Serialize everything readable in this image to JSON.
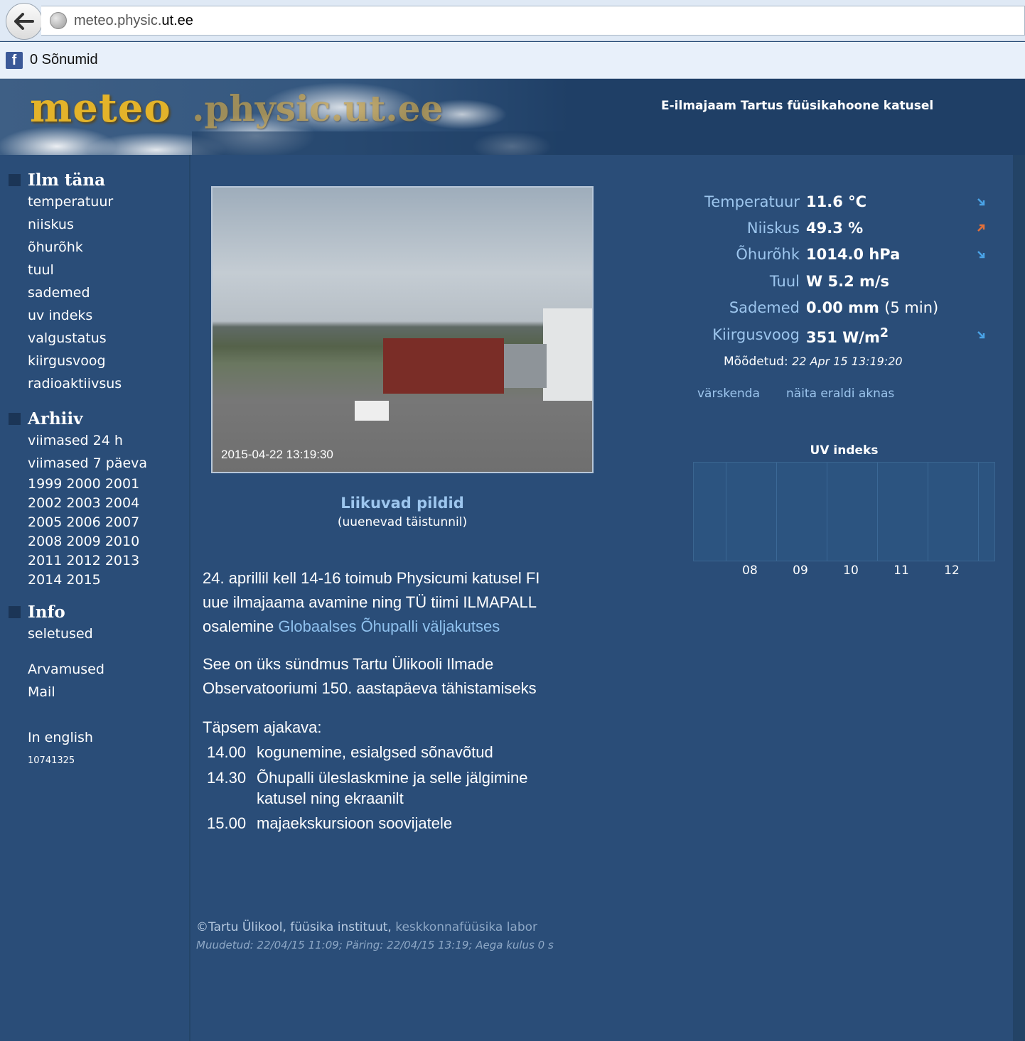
{
  "browser": {
    "url_prefix": "meteo.physic.",
    "url_domain": "ut.ee",
    "bookmark_label": "0 Sõnumid"
  },
  "header": {
    "logo_main": "meteo",
    "logo_domain": ".physic.ut.ee",
    "tagline": "E-ilmajaam Tartus füüsikahoone katusel"
  },
  "sidebar": {
    "today_title": "Ilm täna",
    "today_items": [
      "temperatuur",
      "niiskus",
      "õhurõhk",
      "tuul",
      "sademed",
      "uv indeks",
      "valgustatus",
      "kiirgusvoog",
      "radioaktiivsus"
    ],
    "archive_title": "Arhiiv",
    "archive_items": [
      "viimased 24 h",
      "viimased 7 päeva"
    ],
    "years": [
      [
        "1999",
        "2000",
        "2001"
      ],
      [
        "2002",
        "2003",
        "2004"
      ],
      [
        "2005",
        "2006",
        "2007"
      ],
      [
        "2008",
        "2009",
        "2010"
      ],
      [
        "2011",
        "2012",
        "2013"
      ],
      [
        "2014",
        "2015"
      ]
    ],
    "info_title": "Info",
    "info_items": [
      "seletused"
    ],
    "extra_items": [
      "Arvamused",
      "Mail"
    ],
    "english": "In english",
    "counter": "10741325"
  },
  "webcam": {
    "timestamp": "2015-04-22 13:19:30",
    "link_label": "Liikuvad pildid",
    "link_sub": "(uuenevad täistunnil)"
  },
  "news": {
    "p1_line1": "24. aprillil kell 14-16 toimub Physicumi katusel FI",
    "p1_line2": "uue ilmajaama avamine ning TÜ tiimi ILMAPALL",
    "p1_line3_prefix": "osalemine ",
    "p1_link": "Globaalses Õhupalli väljakutses",
    "p2_line1": "See on üks sündmus Tartu Ülikooli Ilmade",
    "p2_line2": "Observatooriumi 150. aastapäeva tähistamiseks",
    "schedule_title": "Täpsem ajakava:",
    "schedule": [
      {
        "time": "14.00",
        "text": "kogunemine, esialgsed sõnavõtud"
      },
      {
        "time": "14.30",
        "text": "Õhupalli üleslaskmine ja selle jälgimine",
        "text2": "katusel ning ekraanilt"
      },
      {
        "time": "15.00",
        "text": "majaekskursioon soovijatele"
      }
    ]
  },
  "readings": {
    "temperature": {
      "label": "Temperatuur",
      "value": "11.6 °C",
      "trend": "down"
    },
    "humidity": {
      "label": "Niiskus",
      "value": "49.3 %",
      "trend": "up"
    },
    "pressure": {
      "label": "Õhurõhk",
      "value": "1014.0 hPa",
      "trend": "down"
    },
    "wind": {
      "label": "Tuul",
      "value": "W 5.2 m/s"
    },
    "precip": {
      "label": "Sademed",
      "value": "0.00 mm",
      "note": "(5 min)"
    },
    "radiation": {
      "label": "Kiirgusvoog",
      "value": "351 W/m",
      "sup": "2",
      "trend": "down"
    },
    "measured_label": "Mõõdetud:",
    "measured_time": "22 Apr 15 13:19:20",
    "refresh": "värskenda",
    "separate_window": "näita eraldi aknas"
  },
  "uv_chart": {
    "title": "UV indeks",
    "ticks": [
      "08",
      "09",
      "10",
      "11",
      "12"
    ]
  },
  "footer": {
    "copyright_prefix": "©Tartu Ülikool, füüsika instituut, ",
    "lab": "keskkonnafüüsika labor",
    "modified": "Muudetud: 22/04/15 11:09; Päring: 22/04/15 13:19; Aega kulus 0 s"
  },
  "colors": {
    "page_bg": "#2a4d78",
    "link": "#9dc6ee",
    "trend_down": "#4aa3e6",
    "trend_up": "#e2703a"
  }
}
